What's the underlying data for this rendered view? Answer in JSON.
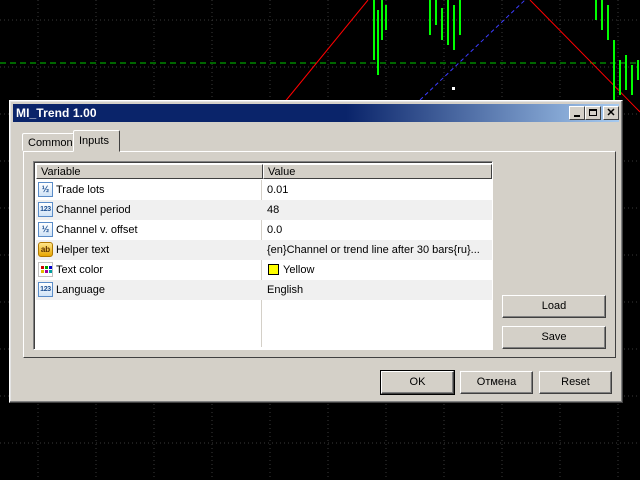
{
  "window": {
    "title": "MI_Trend 1.00",
    "minimize_icon": "minimize-icon",
    "maximize_icon": "maximize-icon",
    "close_glyph": "✕"
  },
  "tabs": [
    {
      "label": "Common",
      "active": false
    },
    {
      "label": "Inputs",
      "active": true
    }
  ],
  "table": {
    "columns": [
      "Variable",
      "Value"
    ],
    "rows": [
      {
        "name": "Trade lots",
        "value": "0.01",
        "type_icon": "fraction-type-icon",
        "icon_text": "½"
      },
      {
        "name": "Channel period",
        "value": "48",
        "type_icon": "integer-type-icon",
        "icon_text": "123"
      },
      {
        "name": "Channel v. offset",
        "value": "0.0",
        "type_icon": "fraction-type-icon",
        "icon_text": "½"
      },
      {
        "name": "Helper text",
        "value": "{en}Channel or trend line after 30 bars{ru}...",
        "type_icon": "string-type-icon",
        "icon_text": "ab"
      },
      {
        "name": "Text color",
        "value": "Yellow",
        "type_icon": "color-type-icon",
        "swatch_color": "#ffff00"
      },
      {
        "name": "Language",
        "value": "English",
        "type_icon": "integer-type-icon",
        "icon_text": "123"
      }
    ]
  },
  "side_buttons": {
    "load_label": "Load",
    "save_label": "Save"
  },
  "footer_buttons": {
    "ok_label": "OK",
    "cancel_label": "Отмена",
    "reset_label": "Reset"
  },
  "colors": {
    "chart_background": "#000000",
    "grid_line": "#3a3a3a",
    "candle_green": "#00ff00",
    "trend_red": "#ff0000",
    "channel_blue": "#3c3cff",
    "dialog_face": "#d4d0c8",
    "titlebar_start": "#0a246a",
    "titlebar_end": "#a6caf0"
  }
}
